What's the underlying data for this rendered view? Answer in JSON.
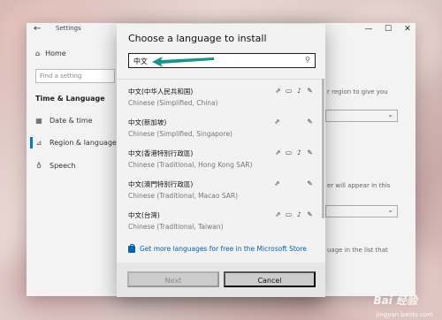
{
  "settings": {
    "title": "Settings",
    "nav": {
      "home": "Home",
      "search_placeholder": "Find a setting",
      "section": "Time & Language",
      "items": [
        {
          "label": "Date & time",
          "icon": "calendar-icon"
        },
        {
          "label": "Region & language",
          "icon": "region-icon"
        },
        {
          "label": "Speech",
          "icon": "microphone-icon"
        }
      ]
    },
    "right_fragments": [
      "r region to give you",
      "er will appear in this",
      "uage in the list that"
    ]
  },
  "dialog": {
    "title": "Choose a language to install",
    "search_value": "中文",
    "languages": [
      {
        "native": "中文(中华人民共和国)",
        "english": "Chinese (Simplified, China)",
        "features": [
          "display-language-icon",
          "text-to-speech-icon",
          "speech-recognition-icon",
          "handwriting-icon"
        ]
      },
      {
        "native": "中文(新加坡)",
        "english": "Chinese (Simplified, Singapore)",
        "features": [
          "display-language-icon",
          "handwriting-icon"
        ]
      },
      {
        "native": "中文(香港特別行政區)",
        "english": "Chinese (Traditional, Hong Kong SAR)",
        "features": [
          "display-language-icon",
          "text-to-speech-icon",
          "speech-recognition-icon",
          "handwriting-icon"
        ]
      },
      {
        "native": "中文(澳門特別行政區)",
        "english": "Chinese (Traditional, Macao SAR)",
        "features": [
          "display-language-icon",
          "handwriting-icon"
        ]
      },
      {
        "native": "中文(台灣)",
        "english": "Chinese (Traditional, Taiwan)",
        "features": [
          "display-language-icon",
          "text-to-speech-icon",
          "speech-recognition-icon",
          "handwriting-icon"
        ]
      }
    ],
    "store_link": "Get more languages for free in the Microsoft Store",
    "next_label": "Next",
    "cancel_label": "Cancel"
  },
  "watermark": {
    "logo": "Bai 经验",
    "url": "jingyan.baidu.com"
  },
  "colors": {
    "accent": "#0078d7",
    "arrow": "#13958a",
    "link": "#0063b1"
  }
}
